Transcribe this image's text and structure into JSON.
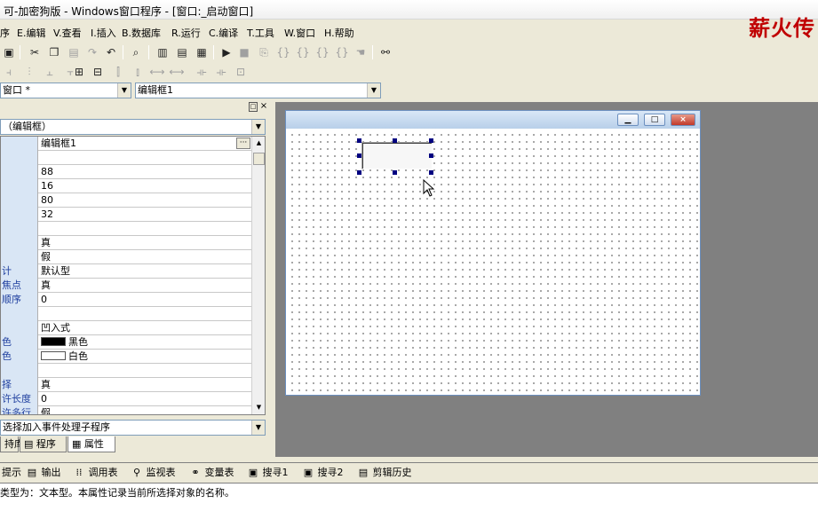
{
  "window": {
    "title": "可-加密狗版 - Windows窗口程序 - [窗口:_启动窗口]"
  },
  "watermark": "薪火传",
  "menu": [
    {
      "label": "序"
    },
    {
      "label": "E.编辑"
    },
    {
      "label": "V.查看"
    },
    {
      "label": "I.插入"
    },
    {
      "label": "B.数据库"
    },
    {
      "label": "R.运行"
    },
    {
      "label": "C.编译"
    },
    {
      "label": "T.工具"
    },
    {
      "label": "W.窗口"
    },
    {
      "label": "H.帮助"
    }
  ],
  "selectors": {
    "window_combo": "窗口 *",
    "control_combo": "编辑框1",
    "object_combo": "（编辑框）",
    "event_combo": "选择加入事件处理子程序"
  },
  "properties": [
    {
      "name": "",
      "value": "编辑框1"
    },
    {
      "name": "",
      "value": ""
    },
    {
      "name": "",
      "value": "88"
    },
    {
      "name": "",
      "value": "16"
    },
    {
      "name": "",
      "value": "80"
    },
    {
      "name": "",
      "value": "32"
    },
    {
      "name": "",
      "value": ""
    },
    {
      "name": "",
      "value": "真"
    },
    {
      "name": "",
      "value": "假"
    },
    {
      "name": "计",
      "value": "默认型"
    },
    {
      "name": "焦点",
      "value": "真"
    },
    {
      "name": "顺序",
      "value": "0"
    },
    {
      "name": "",
      "value": ""
    },
    {
      "name": "",
      "value": "凹入式"
    },
    {
      "name": "色",
      "value": "黑色",
      "swatch": "#000000"
    },
    {
      "name": "色",
      "value": "白色",
      "swatch": "#ffffff"
    },
    {
      "name": "",
      "value": ""
    },
    {
      "name": "择",
      "value": "真"
    },
    {
      "name": "许长度",
      "value": "0"
    },
    {
      "name": "许多行",
      "value": "假"
    }
  ],
  "panel_tabs": [
    {
      "label": "持库"
    },
    {
      "label": "程序"
    },
    {
      "label": "属性"
    }
  ],
  "bottom_tabs": [
    {
      "label": "提示",
      "icon": "▤"
    },
    {
      "label": "输出",
      "icon": "▤"
    },
    {
      "label": "调用表",
      "icon": "⁞⁞"
    },
    {
      "label": "监视表",
      "icon": "⚲"
    },
    {
      "label": "变量表",
      "icon": "⚭"
    },
    {
      "label": "搜寻1",
      "icon": "▣"
    },
    {
      "label": "搜寻2",
      "icon": "▣"
    },
    {
      "label": "剪辑历史",
      "icon": "▤"
    }
  ],
  "status": "类型为：文本型。本属性记录当前所选择对象的名称。",
  "colors": {
    "accent": "#000080",
    "watermark": "#c00000",
    "name_column": "#d9e6f5"
  }
}
